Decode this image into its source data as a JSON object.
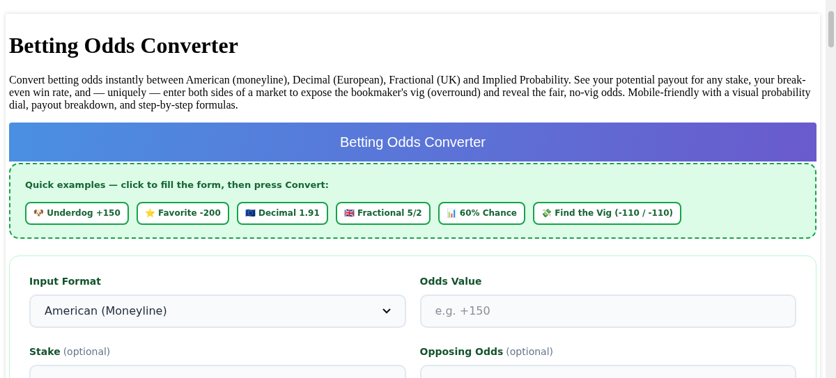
{
  "title": "Betting Odds Converter",
  "intro": "Convert betting odds instantly between American (moneyline), Decimal (European), Fractional (UK) and Implied Probability. See your potential payout for any stake, your break-even win rate, and — uniquely — enter both sides of a market to expose the bookmaker's vig (overround) and reveal the fair, no-vig odds. Mobile-friendly with a visual probability dial, payout breakdown, and step-by-step formulas.",
  "tool_header": "Betting Odds Converter",
  "examples": {
    "label": "Quick examples — click to fill the form, then press Convert:",
    "buttons": [
      "🐶 Underdog +150",
      "⭐ Favorite -200",
      "🇪🇺 Decimal 1.91",
      "🇬🇧 Fractional 5/2",
      "📊 60% Chance",
      "💸 Find the Vig (-110 / -110)"
    ]
  },
  "form": {
    "fields": [
      {
        "kind": "select",
        "label": "Input Format",
        "value": "American (Moneyline)"
      },
      {
        "kind": "input",
        "label": "Odds Value",
        "placeholder": "e.g. +150"
      },
      {
        "kind": "input",
        "label": "Stake",
        "hint": "(optional)"
      },
      {
        "kind": "input",
        "label": "Opposing Odds",
        "hint": "(optional)"
      }
    ]
  }
}
